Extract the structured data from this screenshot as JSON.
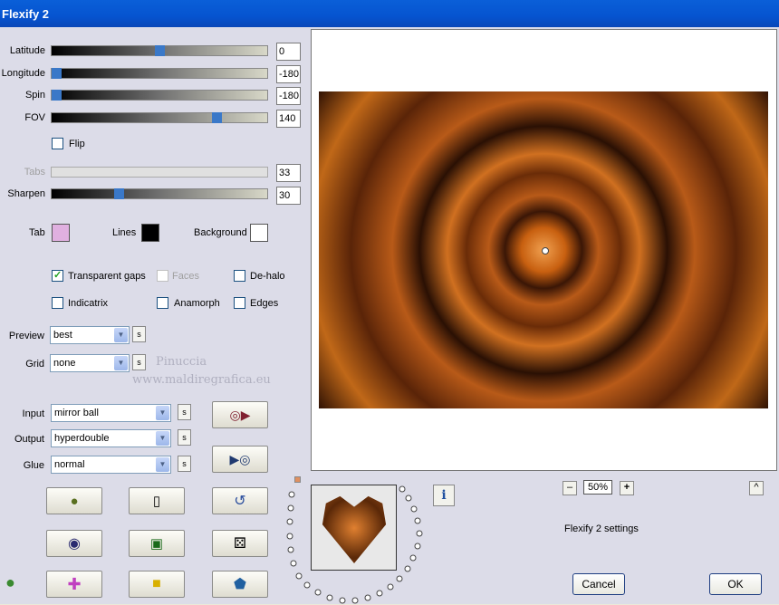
{
  "window": {
    "title": "Flexify 2"
  },
  "sliders": [
    {
      "label": "Latitude",
      "value": "0",
      "pos": 0.5
    },
    {
      "label": "Longitude",
      "value": "-180",
      "pos": 0.0
    },
    {
      "label": "Spin",
      "value": "-180",
      "pos": 0.0
    },
    {
      "label": "FOV",
      "value": "140",
      "pos": 0.78
    }
  ],
  "flip": {
    "label": "Flip",
    "checked": false
  },
  "tabs": {
    "label": "Tabs",
    "value": "33"
  },
  "sharpen": {
    "label": "Sharpen",
    "value": "30",
    "pos": 0.3
  },
  "colors": {
    "tab_label": "Tab",
    "tab_color": "#e0b0e0",
    "lines_label": "Lines",
    "lines_color": "#000000",
    "background_label": "Background",
    "background_color": "#ffffff"
  },
  "options": {
    "transparent_gaps": "Transparent gaps",
    "faces": "Faces",
    "dehalo": "De-halo",
    "indicatrix": "Indicatrix",
    "anamorph": "Anamorph",
    "edges": "Edges"
  },
  "preview": {
    "label": "Preview",
    "value": "best"
  },
  "grid": {
    "label": "Grid",
    "value": "none"
  },
  "watermark": {
    "line1": "Pinuccia",
    "line2": "www.maldiregrafica.eu"
  },
  "input": {
    "label": "Input",
    "value": "mirror ball"
  },
  "output": {
    "label": "Output",
    "value": "hyperdouble"
  },
  "glue": {
    "label": "Glue",
    "value": "normal"
  },
  "s_label": "s",
  "zoom": {
    "minus": "–",
    "value": "50%",
    "plus": "+"
  },
  "status": "Flexify 2 settings",
  "info_label": "i",
  "buttons": {
    "cancel": "Cancel",
    "ok": "OK"
  },
  "icons": [
    "globe-icon",
    "page-icon",
    "undo-icon",
    "ring-icon",
    "square-icon",
    "dice-icon",
    "frog-icon",
    "cross-icon",
    "cube-icon",
    "pentagon-icon",
    "load-icon",
    "save-icon",
    "up-icon"
  ]
}
